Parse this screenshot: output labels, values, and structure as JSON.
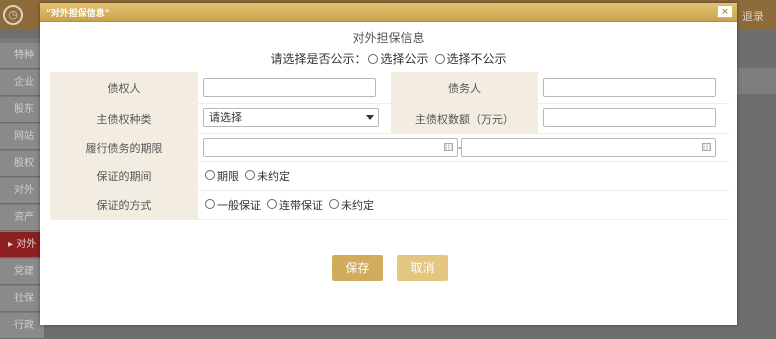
{
  "background": {
    "clock_glyph": "◷",
    "right_text": "退录",
    "sidebar_items": [
      "特种",
      "企业",
      "股东",
      "网站",
      "股权",
      "对外",
      "资产",
      "▸ 对外",
      "党建",
      "社保",
      "行政"
    ]
  },
  "dialog": {
    "title": "\"对外担保信息\"",
    "close_label": "×",
    "heading": "对外担保信息",
    "publicity": {
      "prompt": "请选择是否公示：",
      "options": [
        "选择公示",
        "选择不公示"
      ]
    },
    "fields": {
      "creditor_label": "债权人",
      "creditor_value": "",
      "debtor_label": "债务人",
      "debtor_value": "",
      "claim_type_label": "主债权种类",
      "claim_type_value": "请选择",
      "claim_amount_label": "主债权数额（万元）",
      "claim_amount_value": "",
      "term_label": "履行债务的期限",
      "term_start": "",
      "term_separator": "-",
      "term_end": "",
      "guarantee_period_label": "保证的期间",
      "guarantee_period_options": [
        "期限",
        "未约定"
      ],
      "guarantee_method_label": "保证的方式",
      "guarantee_method_options": [
        "一般保证",
        "连带保证",
        "未约定"
      ]
    },
    "buttons": {
      "save": "保存",
      "cancel": "取消"
    }
  }
}
